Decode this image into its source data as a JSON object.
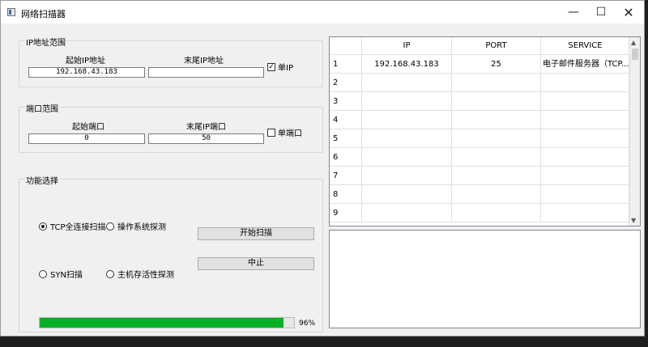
{
  "window": {
    "title": "网络扫描器",
    "controls": {
      "minimize": "—",
      "maximize": "☐",
      "close": "✕"
    }
  },
  "ip_group": {
    "title": "IP地址范围",
    "start_label": "起始IP地址",
    "end_label": "末尾IP地址",
    "start_value": "192.168.43.183",
    "end_value": "",
    "single_label": "单IP",
    "single_checked": true
  },
  "port_group": {
    "title": "端口范围",
    "start_label": "起始端口",
    "end_label": "末尾IP端口",
    "start_value": "0",
    "end_value": "50",
    "single_label": "单端口",
    "single_checked": false
  },
  "func_group": {
    "title": "功能选择",
    "options": [
      {
        "label": "TCP全连接扫描",
        "selected": true
      },
      {
        "label": "操作系统探测",
        "selected": false
      },
      {
        "label": "SYN扫描",
        "selected": false
      },
      {
        "label": "主机存活性探测",
        "selected": false
      }
    ],
    "start_button": "开始扫描",
    "stop_button": "中止",
    "progress": 96,
    "progress_text": "96%"
  },
  "results_table": {
    "columns": [
      "IP",
      "PORT",
      "SERVICE"
    ],
    "row_labels": [
      "1",
      "2",
      "3",
      "4",
      "5",
      "6",
      "7",
      "8",
      "9"
    ],
    "rows": [
      [
        "192.168.43.183",
        "25",
        "电子邮件服务器（TCP..."
      ]
    ]
  },
  "colors": {
    "progress": "#06b025",
    "window_bg": "#f0f0f0"
  }
}
